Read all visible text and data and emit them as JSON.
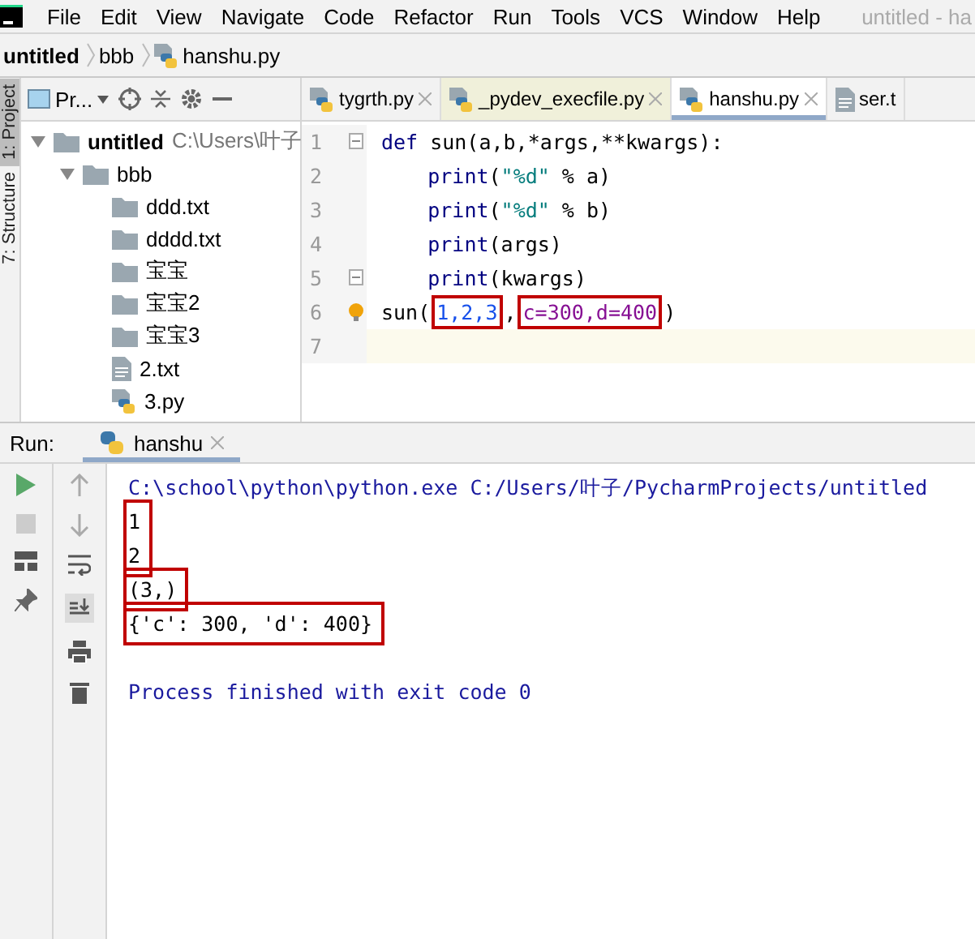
{
  "menu_bar": {
    "items": [
      "File",
      "Edit",
      "View",
      "Navigate",
      "Code",
      "Refactor",
      "Run",
      "Tools",
      "VCS",
      "Window",
      "Help"
    ],
    "title": "untitled - ha"
  },
  "breadcrumb": [
    "untitled",
    "bbb",
    "hanshu.py"
  ],
  "tool_strip": [
    {
      "label": "1: Project",
      "selected": true
    },
    {
      "label": "7: Structure",
      "selected": false
    }
  ],
  "project_panel": {
    "view_selector": "Pr...",
    "tree": [
      {
        "label": "untitled",
        "path": "C:\\Users\\叶子",
        "kind": "folder",
        "expanded": true,
        "children": [
          {
            "label": "bbb",
            "kind": "folder",
            "expanded": true,
            "children": [
              {
                "label": "ddd.txt",
                "kind": "folder"
              },
              {
                "label": "dddd.txt",
                "kind": "folder"
              },
              {
                "label": "宝宝",
                "kind": "folder"
              },
              {
                "label": "宝宝2",
                "kind": "folder"
              },
              {
                "label": "宝宝3",
                "kind": "folder"
              },
              {
                "label": "2.txt",
                "kind": "text"
              },
              {
                "label": "3.py",
                "kind": "python"
              }
            ]
          }
        ]
      }
    ]
  },
  "editor": {
    "tabs": [
      {
        "label": "tygrth.py",
        "kind": "python",
        "selected": false,
        "closable": true
      },
      {
        "label": "_pydev_execfile.py",
        "kind": "python",
        "selected": false,
        "closable": true
      },
      {
        "label": "hanshu.py",
        "kind": "python",
        "selected": true,
        "closable": true
      },
      {
        "label": "ser.t",
        "kind": "text",
        "selected": false,
        "closable": false
      }
    ],
    "lines": [
      {
        "number": "1",
        "fold": true,
        "current": false,
        "tokens": [
          {
            "text": "def ",
            "kind": "keyword"
          },
          {
            "text": "sun(a,b,*args,**kwargs):",
            "kind": "plain"
          }
        ]
      },
      {
        "number": "2",
        "fold": false,
        "current": false,
        "indent": true,
        "tokens": [
          {
            "text": "print",
            "kind": "builtin"
          },
          {
            "text": "(",
            "kind": "plain"
          },
          {
            "text": "\"%d\"",
            "kind": "string"
          },
          {
            "text": " % a)",
            "kind": "plain"
          }
        ]
      },
      {
        "number": "3",
        "fold": false,
        "current": false,
        "indent": true,
        "tokens": [
          {
            "text": "print",
            "kind": "builtin"
          },
          {
            "text": "(",
            "kind": "plain"
          },
          {
            "text": "\"%d\"",
            "kind": "string"
          },
          {
            "text": " % b)",
            "kind": "plain"
          }
        ]
      },
      {
        "number": "4",
        "fold": false,
        "current": false,
        "indent": true,
        "tokens": [
          {
            "text": "print",
            "kind": "builtin"
          },
          {
            "text": "(args)",
            "kind": "plain"
          }
        ]
      },
      {
        "number": "5",
        "fold": true,
        "current": false,
        "indent": true,
        "tokens": [
          {
            "text": "print",
            "kind": "builtin"
          },
          {
            "text": "(kwargs)",
            "kind": "plain"
          }
        ]
      },
      {
        "number": "6",
        "fold": false,
        "current": false,
        "tokens": [
          {
            "text": "sun(",
            "kind": "plain",
            "bulb": true
          },
          {
            "text": "1,2,3",
            "kind": "number",
            "boxed": true
          },
          {
            "text": ",",
            "kind": "plain"
          },
          {
            "text": "c=300,d=400",
            "kind": "keyword_args",
            "boxed": true
          },
          {
            "text": ")",
            "kind": "plain"
          }
        ]
      },
      {
        "number": "7",
        "fold": false,
        "current": true
      }
    ]
  },
  "run_panel": {
    "label": "Run:",
    "tabs": [
      {
        "label": "hanshu",
        "selected": true
      }
    ],
    "output": [
      {
        "text": "C:\\school\\python\\python.exe C:/Users/叶子/PycharmProjects/untitled",
        "kind": "command",
        "boxed": false
      },
      {
        "text": "1\n2",
        "kind": "stdout",
        "boxed": true
      },
      {
        "text": "(3,)",
        "kind": "stdout",
        "boxed": true
      },
      {
        "text": "{'c': 300, 'd': 400}",
        "kind": "stdout",
        "boxed": true
      },
      {
        "text": "Process finished with exit code 0",
        "kind": "status",
        "boxed": false
      }
    ]
  }
}
